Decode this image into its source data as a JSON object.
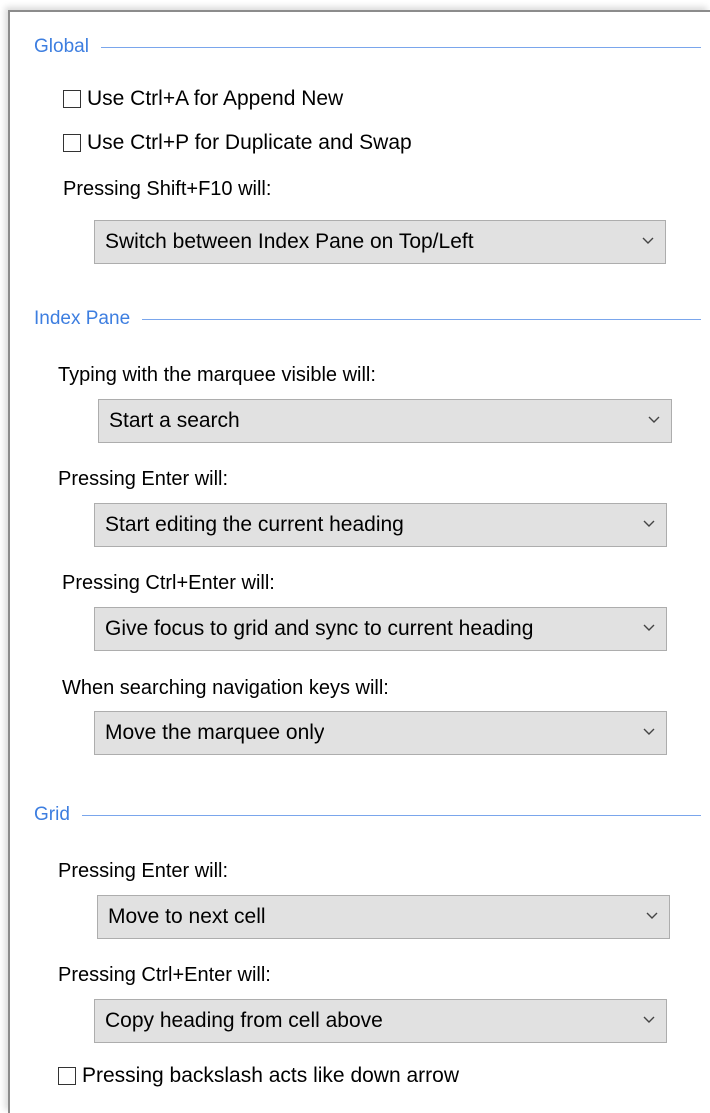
{
  "global": {
    "title": "Global",
    "append_new_label": "Use Ctrl+A for Append New",
    "duplicate_swap_label": "Use Ctrl+P for Duplicate and Swap",
    "shift_f10_label": "Pressing Shift+F10 will:",
    "shift_f10_value": "Switch between Index Pane on Top/Left"
  },
  "index_pane": {
    "title": "Index Pane",
    "typing_label": "Typing with the marquee visible will:",
    "typing_value": "Start a search",
    "enter_label": "Pressing Enter will:",
    "enter_value": "Start editing the current heading",
    "ctrl_enter_label": "Pressing Ctrl+Enter will:",
    "ctrl_enter_value": "Give focus to grid and sync to current heading",
    "searching_label": "When searching navigation keys will:",
    "searching_value": "Move the marquee only"
  },
  "grid": {
    "title": "Grid",
    "enter_label": "Pressing Enter will:",
    "enter_value": "Move to next cell",
    "ctrl_enter_label": "Pressing Ctrl+Enter will:",
    "ctrl_enter_value": "Copy heading from cell above",
    "backslash_label": "Pressing backslash acts like down arrow"
  },
  "checkboxes": {
    "append_new_checked": false,
    "duplicate_swap_checked": false,
    "backslash_checked": false
  }
}
